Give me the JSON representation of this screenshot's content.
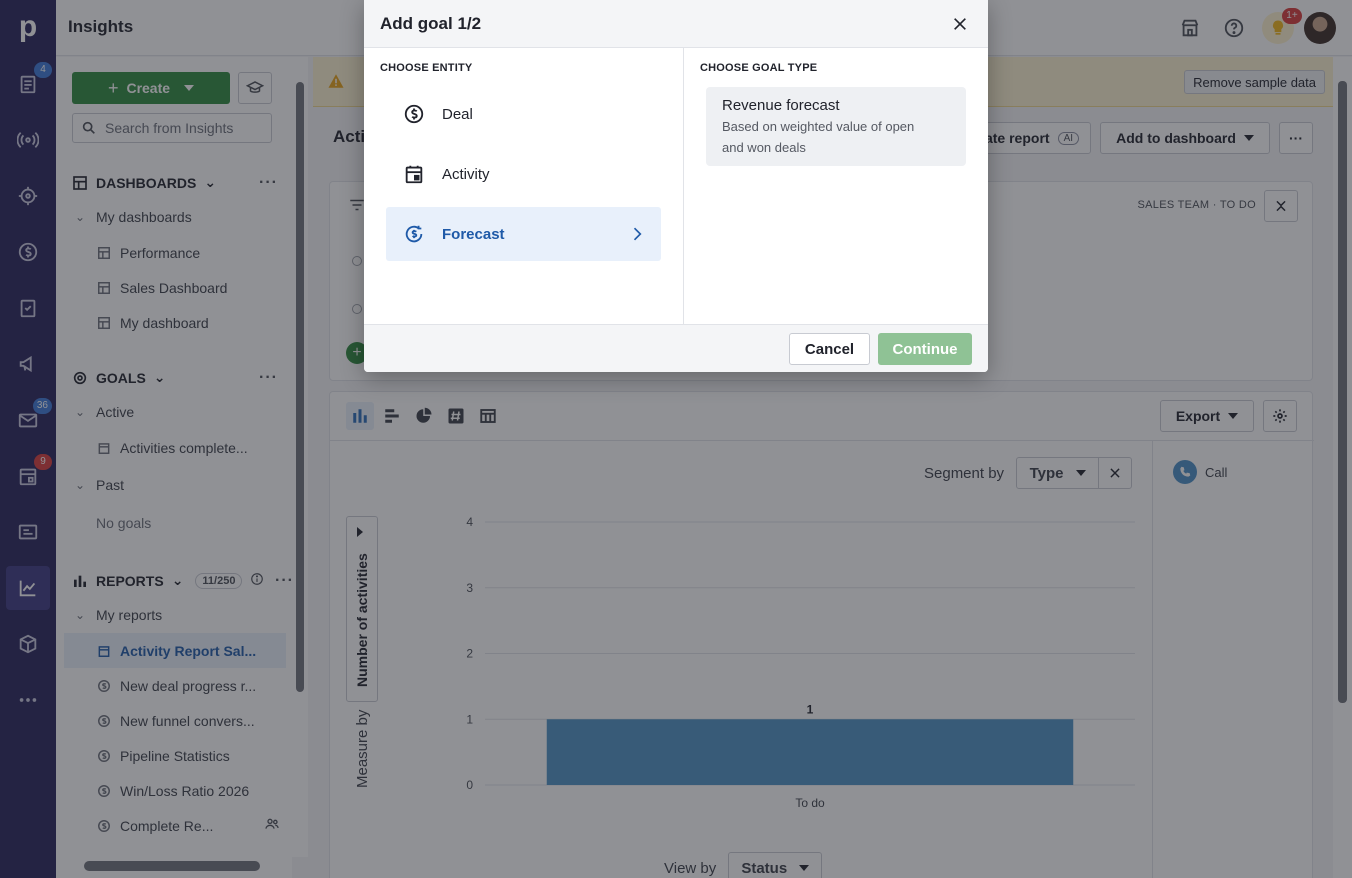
{
  "header": {
    "title": "Insights",
    "notification_badge": "1+"
  },
  "rail": {
    "badges": {
      "leads": "4",
      "mail": "36",
      "calendar": "9"
    }
  },
  "sidebar": {
    "create_label": "Create",
    "search_placeholder": "Search from Insights",
    "dashboards": {
      "title": "DASHBOARDS",
      "group_label": "My dashboards",
      "items": [
        "Performance",
        "Sales Dashboard",
        "My dashboard"
      ]
    },
    "goals": {
      "title": "GOALS",
      "active_label": "Active",
      "active_items": [
        "Activities complete..."
      ],
      "past_label": "Past",
      "past_empty": "No goals"
    },
    "reports": {
      "title": "REPORTS",
      "count": "11/250",
      "group_label": "My reports",
      "items": [
        "Activity Report Sal...",
        "New deal progress r...",
        "New funnel convers...",
        "Pipeline Statistics",
        "Win/Loss Ratio 2026",
        "Complete Re..."
      ]
    }
  },
  "main": {
    "report_title": "Acti",
    "remove_sample_label": "Remove sample data",
    "generate_report_label": "ate report",
    "ai_tag": "AI",
    "add_dashboard_label": "Add to dashboard",
    "filter_tags": "SALES TEAM  ·  TO DO",
    "export_label": "Export",
    "segment_by_label": "Segment by",
    "segment_value": "Type",
    "legend_item": "Call",
    "measure_value": "Number of activities",
    "measure_by_label": "Measure by",
    "view_by_label": "View by",
    "view_by_value": "Status"
  },
  "chart_data": {
    "type": "bar",
    "categories": [
      "To do"
    ],
    "values": [
      1
    ],
    "data_labels": [
      "1"
    ],
    "ylim": [
      0,
      4
    ],
    "yticks": [
      "0",
      "1",
      "2",
      "3",
      "4"
    ],
    "xlabel": "",
    "ylabel": "",
    "grid": true,
    "color": "#4f93c4"
  },
  "modal": {
    "title": "Add goal 1/2",
    "entity_header": "CHOOSE ENTITY",
    "entities": [
      "Deal",
      "Activity",
      "Forecast"
    ],
    "selected_entity": "Forecast",
    "goal_type_header": "CHOOSE GOAL TYPE",
    "goal_type_title": "Revenue forecast",
    "goal_type_desc": "Based on weighted value of open and won deals",
    "cancel_label": "Cancel",
    "continue_label": "Continue"
  }
}
